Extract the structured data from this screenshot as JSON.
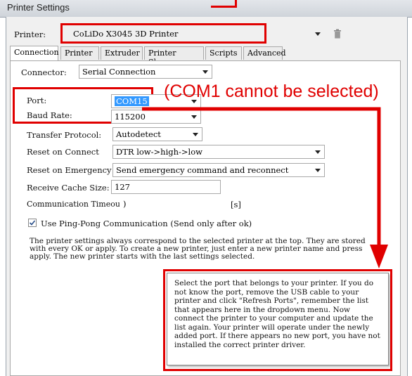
{
  "window": {
    "title": "Printer Settings"
  },
  "printer": {
    "label": "Printer:",
    "value": "CoLiDo X3045 3D Printer"
  },
  "tabs": [
    "Connection",
    "Printer",
    "Extruder",
    "Printer Shape",
    "Scripts",
    "Advanced"
  ],
  "connector": {
    "label": "Connector:",
    "value": "Serial Connection"
  },
  "port": {
    "label": "Port:",
    "value": "COM15"
  },
  "baud": {
    "label": "Baud Rate:",
    "value": "115200"
  },
  "transfer": {
    "label": "Transfer Protocol:",
    "value": "Autodetect"
  },
  "reset_connect": {
    "label": "Reset on Connect",
    "value": "DTR low->high->low"
  },
  "reset_emergency": {
    "label": "Reset on Emergency",
    "value": "Send emergency command and reconnect"
  },
  "cache": {
    "label": "Receive Cache Size:",
    "value": "127"
  },
  "timeout": {
    "label": "Communication Timeout:",
    "value": ")",
    "unit": "[s]"
  },
  "pingpong": {
    "label": "Use Ping-Pong Communication (Send only after ok)",
    "checked": true
  },
  "info_text": "The printer settings always correspond to the selected printer at the top. They are stored with every OK or apply. To create a new printer, just enter a new printer name and press apply. The new printer starts with the last settings selected.",
  "popup_text": "Select the port that belongs to your printer. If you do not know the port, remove the USB cable to your printer and click \"Refresh Ports\", remember the list that appears here in the dropdown menu. Now connect the printer to your computer and update the list again. Your printer will operate under the newly added port. If there appears no new port, you have not installed the correct printer driver.",
  "annotation": "(COM1 cannot be selected)",
  "colors": {
    "annotation": "#e00000",
    "selection": "#3399ff"
  }
}
